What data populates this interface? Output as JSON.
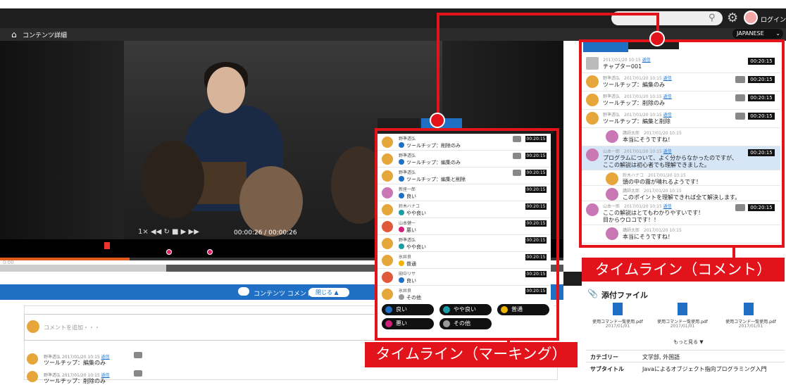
{
  "header": {
    "login_label": "ログイン",
    "page_title": "コンテンツ詳細",
    "language": "JAPANESE"
  },
  "player": {
    "controls": "1×  ◀◀ ↻ ■ ▶ ▶▶",
    "time": "00:00:26 / 00:00:26",
    "time_start": "0:00",
    "progress_fraction": 0.23
  },
  "comment_section": {
    "bar_label": "コンテンツ コメント",
    "close_label": "閉じる ▲",
    "placeholder": "コメントを追加・・・",
    "items": [
      {
        "meta_name": "野準透弘",
        "meta_date": "2017/01/20 10:15",
        "reply": "返信",
        "text": "ツールチップ：編集のみ"
      },
      {
        "meta_name": "野準透弘",
        "meta_date": "2017/01/20 10:15",
        "reply": "返信",
        "text": "ツールチップ：削除のみ"
      }
    ]
  },
  "marking_timeline": {
    "rows": [
      {
        "name": "野準透弘",
        "label": "ツールチップ：削除のみ",
        "time": "00:20:15",
        "dot": "#1f6fc5",
        "avatar": "#e7a63a"
      },
      {
        "name": "野準透弘",
        "label": "ツールチップ：編集のみ",
        "time": "00:20:15",
        "dot": "#1f6fc5",
        "avatar": "#e7a63a"
      },
      {
        "name": "野準透弘",
        "label": "ツールチップ：編集と削除",
        "time": "00:20:15",
        "dot": "#1f6fc5",
        "avatar": "#e7a63a"
      },
      {
        "name": "新座一郎",
        "label": "良い",
        "time": "00:20:15",
        "dot": "#1f6fc5",
        "avatar": "#c978b5"
      },
      {
        "name": "鈴木ハナコ",
        "label": "やや良い",
        "time": "00:20:15",
        "dot": "#1a9ba8",
        "avatar": "#e7a63a"
      },
      {
        "name": "山本健一",
        "label": "悪い",
        "time": "00:20:15",
        "dot": "#d0207a",
        "avatar": "#e05a3a"
      },
      {
        "name": "野準透弘",
        "label": "やや良い",
        "time": "00:20:15",
        "dot": "#1a9ba8",
        "avatar": "#e7a63a"
      },
      {
        "name": "氷井良",
        "label": "普通",
        "time": "00:20:15",
        "dot": "#f0b400",
        "avatar": "#e7a63a"
      },
      {
        "name": "田中リサ",
        "label": "良い",
        "time": "00:20:15",
        "dot": "#1f6fc5",
        "avatar": "#e05a3a"
      },
      {
        "name": "氷井良",
        "label": "その他",
        "time": "00:20:15",
        "dot": "#999999",
        "avatar": "#e7a63a"
      }
    ],
    "buttons": [
      {
        "label": "良い",
        "dot": "#1f6fc5"
      },
      {
        "label": "やや良い",
        "dot": "#1a9ba8"
      },
      {
        "label": "普通",
        "dot": "#f0b400"
      },
      {
        "label": "悪い",
        "dot": "#d0207a"
      },
      {
        "label": "その他",
        "dot": "#999999"
      }
    ]
  },
  "comment_timeline": {
    "rows": [
      {
        "meta": "2017/01/20 10:15",
        "reply": "返信",
        "text": "チャプター001",
        "time": "00:20:15"
      },
      {
        "meta": "野準透弘　2017/01/20 10:15",
        "reply": "返信",
        "text": "ツールチップ：編集のみ",
        "time": "00:20:15"
      },
      {
        "meta": "野準透弘　2017/01/20 10:15",
        "reply": "返信",
        "text": "ツールチップ：削除のみ",
        "time": "00:20:15"
      },
      {
        "meta": "野準透弘　2017/01/20 10:15",
        "reply": "返信",
        "text": "ツールチップ：編集と削除",
        "time": "00:20:15"
      },
      {
        "meta": "講師太郎　2017/01/20 10:15",
        "text": "本当にそうですね！"
      },
      {
        "meta": "山本一郎　2017/01/20 10:15",
        "reply": "返信",
        "text": "プログラムについて、よく分からなかったのですが、",
        "text2": "ここの解説は初心者でも理解できました。",
        "time": "00:20:15"
      },
      {
        "meta": "鈴木ハナコ　2017/01/20 10:15",
        "text": "頭の中の霧が晴れるようです！"
      },
      {
        "meta": "講師太郎　2017/01/20 10:15",
        "text": "このポイントを理解できれば全て解決します。"
      },
      {
        "meta": "山本一郎　2017/01/20 10:15",
        "reply": "返信",
        "text": "ここの解説はとてもわかりやすいです！",
        "text2": "目からウロコです！！",
        "time": "00:20:15"
      },
      {
        "meta": "講師太郎　2017/01/20 10:15",
        "text": "本当にそうですね！"
      }
    ]
  },
  "callouts": {
    "comment": "タイムライン（コメント）",
    "marking": "タイムライン（マーキング）"
  },
  "attachments": {
    "title": "添付ファイル",
    "files": [
      {
        "name": "使用コマンド一覧使用.pdf",
        "date": "2017/01/01"
      },
      {
        "name": "使用コマンド一覧使用.pdf",
        "date": "2017/01/01"
      },
      {
        "name": "使用コマンド一覧使用.pdf",
        "date": "2017/01/01"
      }
    ],
    "more": "もっと見る ▼"
  },
  "meta_table": [
    {
      "key": "カテゴリー",
      "value": "文学部, 外国語"
    },
    {
      "key": "サブタイトル",
      "value": "Javaによるオブジェクト指向プログラミング入門"
    }
  ]
}
